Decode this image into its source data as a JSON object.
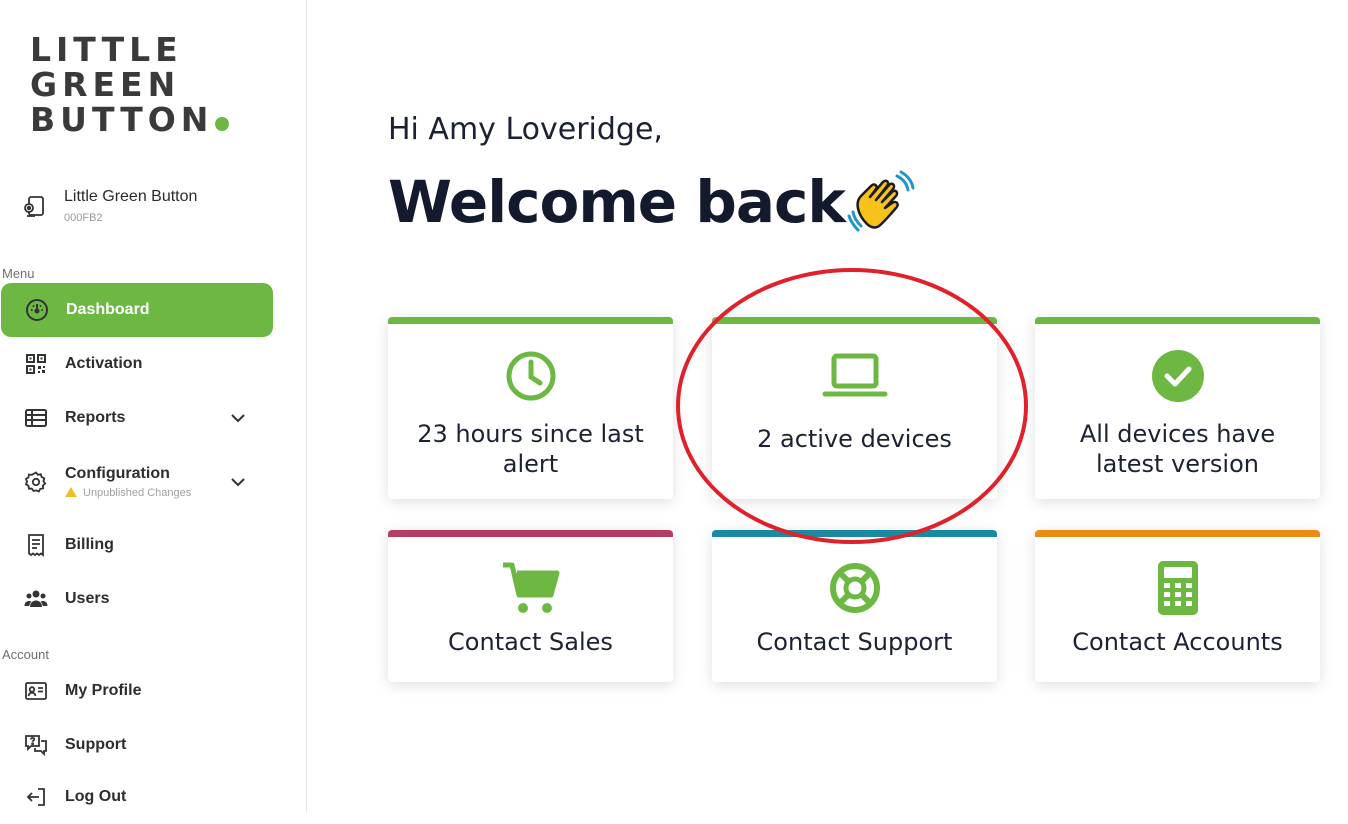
{
  "logo": {
    "line1": "LITTLE",
    "line2": "GREEN",
    "line3": "BUTTON"
  },
  "org": {
    "name": "Little Green Button",
    "code": "000FB2"
  },
  "sidebar": {
    "menu_label": "Menu",
    "account_label": "Account",
    "items": [
      {
        "label": "Dashboard",
        "icon": "gauge-icon",
        "active": true
      },
      {
        "label": "Activation",
        "icon": "qr-code-icon"
      },
      {
        "label": "Reports",
        "icon": "table-icon",
        "expandable": true
      },
      {
        "label": "Configuration",
        "icon": "gear-icon",
        "expandable": true,
        "sublabel": "Unpublished Changes"
      },
      {
        "label": "Billing",
        "icon": "receipt-icon"
      },
      {
        "label": "Users",
        "icon": "users-icon"
      }
    ],
    "account_items": [
      {
        "label": "My Profile",
        "icon": "id-card-icon"
      },
      {
        "label": "Support",
        "icon": "chat-help-icon"
      },
      {
        "label": "Log Out",
        "icon": "log-out-icon"
      }
    ]
  },
  "main": {
    "greeting": "Hi Amy Loveridge,",
    "welcome": "Welcome back",
    "cards": [
      {
        "text": "23 hours since last alert",
        "icon": "clock-icon",
        "accent": "#6db843"
      },
      {
        "text": "2 active devices",
        "icon": "laptop-icon",
        "accent": "#6db843"
      },
      {
        "text": "All devices have latest version",
        "icon": "check-circle-icon",
        "accent": "#6db843"
      },
      {
        "text": "Contact Sales",
        "icon": "cart-icon",
        "accent": "#b53d62"
      },
      {
        "text": "Contact Support",
        "icon": "lifebuoy-icon",
        "accent": "#1a8aa1"
      },
      {
        "text": "Contact Accounts",
        "icon": "calculator-icon",
        "accent": "#ee8c12"
      }
    ]
  },
  "colors": {
    "brand_green": "#6db843",
    "annotation_red": "#e0202a"
  }
}
